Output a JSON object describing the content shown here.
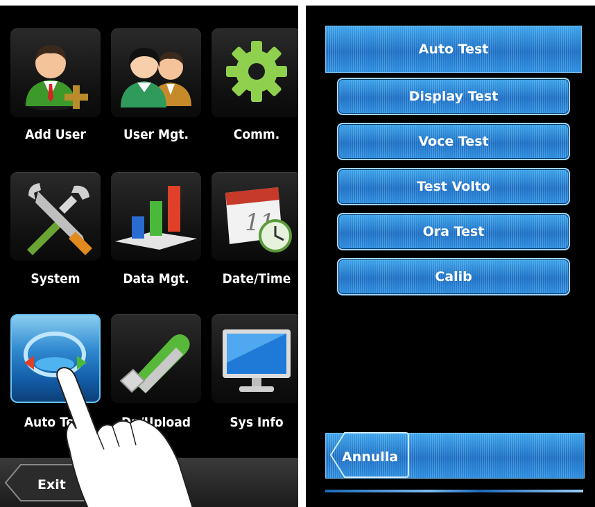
{
  "left_screen": {
    "tiles": [
      {
        "label": "Add User",
        "icon": "add-user-icon"
      },
      {
        "label": "User Mgt.",
        "icon": "users-icon"
      },
      {
        "label": "Comm.",
        "icon": "gear-icon"
      },
      {
        "label": "System",
        "icon": "tools-icon"
      },
      {
        "label": "Data Mgt.",
        "icon": "bar-chart-icon"
      },
      {
        "label": "Date/Time",
        "icon": "calendar-clock-icon"
      },
      {
        "label": "Auto Test",
        "icon": "auto-test-icon"
      },
      {
        "label": "Dn/Upload",
        "icon": "usb-drive-icon"
      },
      {
        "label": "Sys Info",
        "icon": "monitor-icon"
      }
    ],
    "exit_label": "Exit",
    "selected_tile": "Auto Test"
  },
  "right_screen": {
    "title": "Auto Test",
    "menu": [
      {
        "label": "Display Test"
      },
      {
        "label": "Voce Test"
      },
      {
        "label": "Test Volto"
      },
      {
        "label": "Ora Test"
      },
      {
        "label": "Calib"
      }
    ],
    "cancel_label": "Annulla"
  },
  "colors": {
    "accent_blue": "#2a8ddf",
    "background": "#000000",
    "text": "#ffffff"
  }
}
